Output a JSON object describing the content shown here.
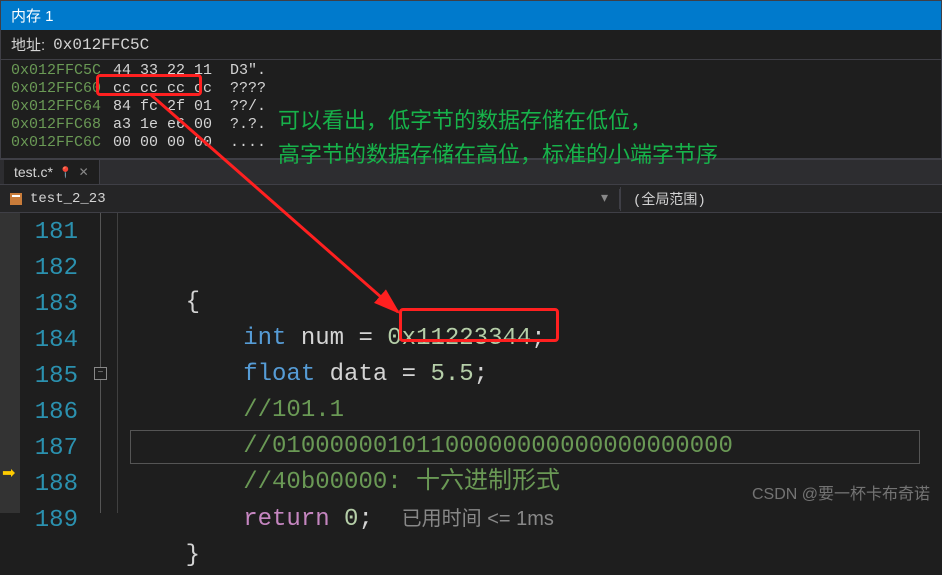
{
  "memory_panel": {
    "title": "内存 1",
    "address_label": "地址:",
    "address_value": "0x012FFC5C",
    "rows": [
      {
        "addr": "0x012FFC5C",
        "bytes": "44 33 22 11",
        "ascii": "D3\"."
      },
      {
        "addr": "0x012FFC60",
        "bytes": "cc cc cc cc",
        "ascii": "????"
      },
      {
        "addr": "0x012FFC64",
        "bytes": "84 fc 2f 01",
        "ascii": "??/."
      },
      {
        "addr": "0x012FFC68",
        "bytes": "a3 1e e6 00",
        "ascii": "?.?."
      },
      {
        "addr": "0x012FFC6C",
        "bytes": "00 00 00 00",
        "ascii": "...."
      }
    ]
  },
  "tab": {
    "name": "test.c*",
    "pin": "📌"
  },
  "scope": {
    "left": "test_2_23",
    "right": "(全局范围)"
  },
  "annotation": {
    "line1": "可以看出，低字节的数据存储在低位，",
    "line2": "高字节的数据存储在高位，标准的小端字节序"
  },
  "code": {
    "lines": [
      "181",
      "182",
      "183",
      "184",
      "185",
      "186",
      "187",
      "188",
      "189"
    ],
    "l182": "{",
    "l183_kw": "int",
    "l183_var": " num = ",
    "l183_val": "0x11223344",
    "l183_semi": ";",
    "l184_kw": "float",
    "l184_var": " data = ",
    "l184_val": "5.5",
    "l184_semi": ";",
    "l185": "//101.1",
    "l186": "//01000000101100000000000000000000",
    "l187": "//40b00000: 十六进制形式",
    "l188_kw": "return",
    "l188_val": " 0",
    "l188_semi": ";",
    "l188_hint": "已用时间 <= 1ms",
    "l189": "}"
  },
  "watermark": "CSDN @要一杯卡布奇诺"
}
